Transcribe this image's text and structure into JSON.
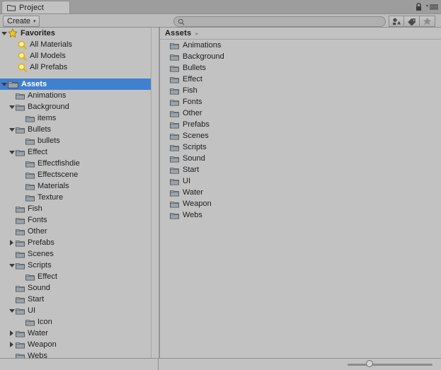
{
  "window": {
    "tab_label": "Project",
    "tab_icon": "folder-icon",
    "lock_icon": "lock-icon",
    "menu_icon": "hamburger-menu-icon"
  },
  "toolbar": {
    "create_label": "Create",
    "create_caret": "▾",
    "search": {
      "value": "",
      "placeholder": "",
      "icon": "search-icon"
    },
    "filters": [
      {
        "name": "filter-by-type-button",
        "icon": "shapes-icon"
      },
      {
        "name": "filter-by-label-button",
        "icon": "tag-icon"
      },
      {
        "name": "filter-favorites-button",
        "icon": "star-icon"
      }
    ]
  },
  "tree": {
    "favorites": {
      "label": "Favorites",
      "icon": "star-icon",
      "expanded": true,
      "items": [
        {
          "label": "All Materials",
          "icon": "search-icon"
        },
        {
          "label": "All Models",
          "icon": "search-icon"
        },
        {
          "label": "All Prefabs",
          "icon": "search-icon"
        }
      ]
    },
    "assets": {
      "label": "Assets",
      "icon": "folder-icon",
      "selected": true,
      "expanded": true,
      "items": [
        {
          "label": "Animations",
          "depth": 1,
          "state": "leaf"
        },
        {
          "label": "Background",
          "depth": 1,
          "state": "open"
        },
        {
          "label": "items",
          "depth": 2,
          "state": "leaf"
        },
        {
          "label": "Bullets",
          "depth": 1,
          "state": "open"
        },
        {
          "label": "bullets",
          "depth": 2,
          "state": "leaf"
        },
        {
          "label": "Effect",
          "depth": 1,
          "state": "open"
        },
        {
          "label": "Effectfishdie",
          "depth": 2,
          "state": "leaf"
        },
        {
          "label": "Effectscene",
          "depth": 2,
          "state": "leaf"
        },
        {
          "label": "Materials",
          "depth": 2,
          "state": "leaf"
        },
        {
          "label": "Texture",
          "depth": 2,
          "state": "leaf"
        },
        {
          "label": "Fish",
          "depth": 1,
          "state": "leaf"
        },
        {
          "label": "Fonts",
          "depth": 1,
          "state": "leaf"
        },
        {
          "label": "Other",
          "depth": 1,
          "state": "leaf"
        },
        {
          "label": "Prefabs",
          "depth": 1,
          "state": "closed"
        },
        {
          "label": "Scenes",
          "depth": 1,
          "state": "leaf"
        },
        {
          "label": "Scripts",
          "depth": 1,
          "state": "open"
        },
        {
          "label": "Effect",
          "depth": 2,
          "state": "leaf"
        },
        {
          "label": "Sound",
          "depth": 1,
          "state": "leaf"
        },
        {
          "label": "Start",
          "depth": 1,
          "state": "leaf"
        },
        {
          "label": "UI",
          "depth": 1,
          "state": "open"
        },
        {
          "label": "Icon",
          "depth": 2,
          "state": "leaf"
        },
        {
          "label": "Water",
          "depth": 1,
          "state": "closed"
        },
        {
          "label": "Weapon",
          "depth": 1,
          "state": "closed"
        },
        {
          "label": "Webs",
          "depth": 1,
          "state": "leaf"
        }
      ]
    }
  },
  "browser": {
    "breadcrumb": "Assets",
    "breadcrumb_arrow": "▸",
    "items": [
      {
        "label": "Animations",
        "icon": "folder-icon"
      },
      {
        "label": "Background",
        "icon": "folder-icon"
      },
      {
        "label": "Bullets",
        "icon": "folder-icon"
      },
      {
        "label": "Effect",
        "icon": "folder-icon"
      },
      {
        "label": "Fish",
        "icon": "folder-icon"
      },
      {
        "label": "Fonts",
        "icon": "folder-icon"
      },
      {
        "label": "Other",
        "icon": "folder-icon"
      },
      {
        "label": "Prefabs",
        "icon": "folder-icon"
      },
      {
        "label": "Scenes",
        "icon": "folder-icon"
      },
      {
        "label": "Scripts",
        "icon": "folder-icon"
      },
      {
        "label": "Sound",
        "icon": "folder-icon"
      },
      {
        "label": "Start",
        "icon": "folder-icon"
      },
      {
        "label": "UI",
        "icon": "folder-icon"
      },
      {
        "label": "Water",
        "icon": "folder-icon"
      },
      {
        "label": "Weapon",
        "icon": "folder-icon"
      },
      {
        "label": "Webs",
        "icon": "folder-icon"
      }
    ]
  },
  "statusbar": {
    "zoom_slider": {
      "name": "icon-size-slider",
      "value": 22
    }
  },
  "colors": {
    "window_bg": "#9d9d9d",
    "panel_bg": "#c2c2c2",
    "toolbar_bg": "#bcbcbc",
    "selection_blue": "#4080d0",
    "favorite_yellow": "#f2c824",
    "text": "#1d1d1d"
  }
}
